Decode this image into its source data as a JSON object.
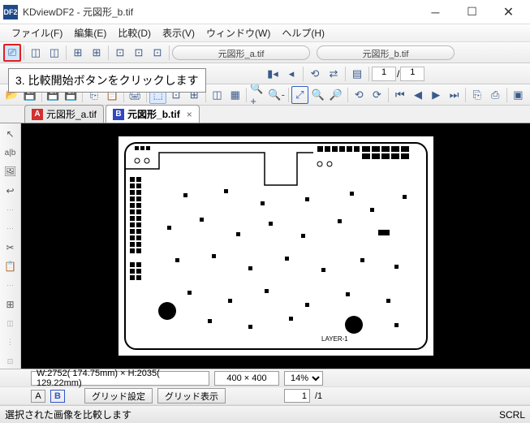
{
  "title": "KDviewDF2 - 元図形_b.tif",
  "menu": {
    "file": "ファイル(F)",
    "edit": "編集(E)",
    "compare": "比較(D)",
    "view": "表示(V)",
    "window": "ウィンドウ(W)",
    "help": "ヘルプ(H)"
  },
  "file_tabs": {
    "a": "元図形_a.tif",
    "b": "元図形_b.tif"
  },
  "tooltip": "3. 比較開始ボタンをクリックします",
  "page_indicator": {
    "cur": "1",
    "total": "1"
  },
  "doc_tabs": {
    "a": "元図形_a.tif",
    "b": "元図形_b.tif"
  },
  "dimensions": "W:2752( 174.75mm) × H:2035( 129.22mm)",
  "resolution": "400 × 400",
  "zoom": "14%",
  "page_box": {
    "cur": "1",
    "total": "/1"
  },
  "btn_grid_settings": "グリッド設定",
  "btn_grid_show": "グリッド表示",
  "a_label": "A",
  "b_label": "B",
  "statusbar_text": "選択された画像を比較します",
  "statusbar_scrl": "SCRL",
  "drawing_label": "LAYER-1"
}
